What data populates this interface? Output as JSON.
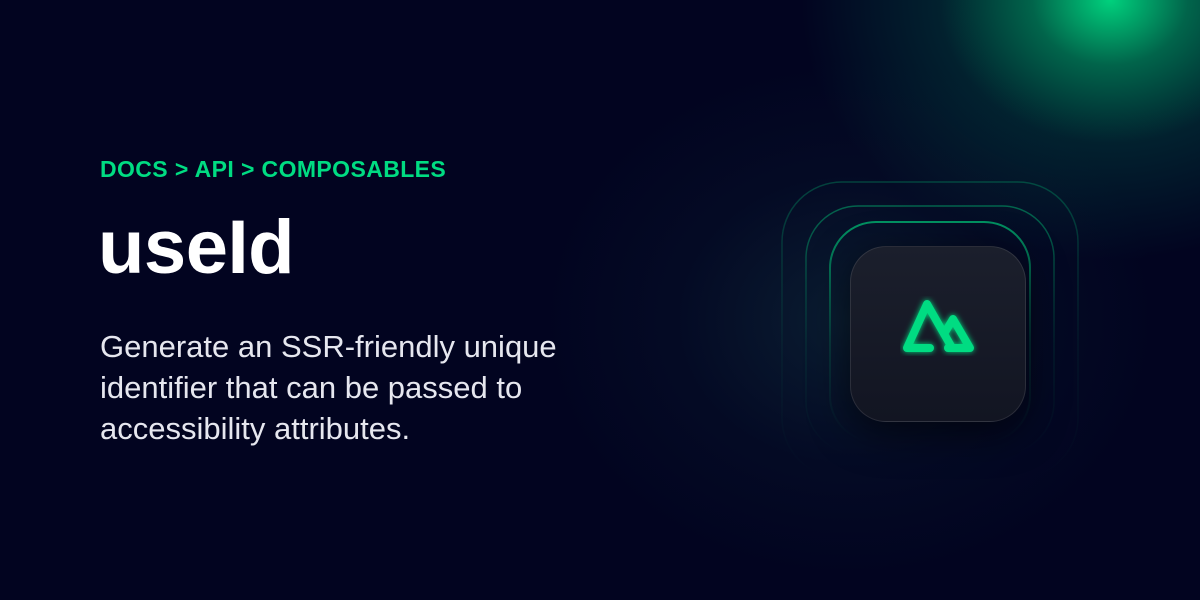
{
  "breadcrumb": "DOCS > API > COMPOSABLES",
  "title": "useId",
  "description": "Generate an SSR-friendly unique identifier that can be passed to accessibility attributes.",
  "logo_icon": "nuxt-logo-icon",
  "colors": {
    "background": "#020420",
    "accent": "#00DC82",
    "title": "#FFFFFF",
    "description": "#E6E7EF"
  }
}
